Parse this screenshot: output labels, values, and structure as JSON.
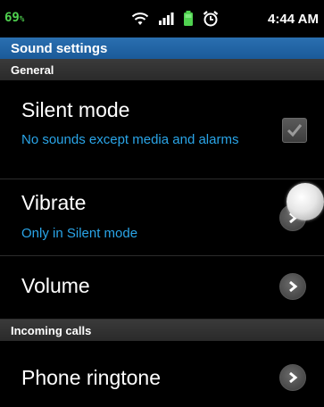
{
  "status_bar": {
    "battery_percent": "69",
    "battery_suffix": "%",
    "time": "4:44 AM",
    "icons": [
      "wifi-icon",
      "signal-icon",
      "battery-icon",
      "alarm-icon"
    ],
    "battery_color": "#4fd14f"
  },
  "title_bar": {
    "title": "Sound settings",
    "color": "#1f64a6"
  },
  "sections": {
    "general": "General",
    "incoming_calls": "Incoming calls"
  },
  "prefs": {
    "silent_mode": {
      "title": "Silent mode",
      "summary": "No sounds except media and alarms",
      "checked": true
    },
    "vibrate": {
      "title": "Vibrate",
      "summary": "Only in Silent mode"
    },
    "volume": {
      "title": "Volume"
    },
    "phone_ringtone": {
      "title": "Phone ringtone"
    }
  },
  "colors": {
    "summary_text": "#2aa5e8",
    "background": "#000000"
  }
}
